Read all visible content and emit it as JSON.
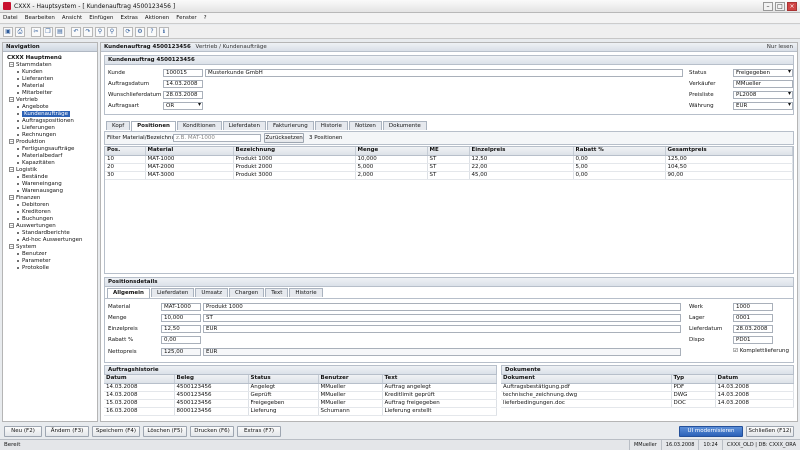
{
  "window": {
    "title": "CXXX - Hauptsystem - [ Kundenauftrag 4500123456 ]"
  },
  "menu": [
    "Datei",
    "Bearbeiten",
    "Ansicht",
    "Einfügen",
    "Extras",
    "Aktionen",
    "Fenster",
    "?"
  ],
  "toolbar_icons": [
    "save-icon",
    "print-icon",
    "cut-icon",
    "copy-icon",
    "paste-icon",
    "undo-icon",
    "redo-icon",
    "find-icon",
    "find-next-icon",
    "refresh-icon",
    "settings-icon",
    "help-icon",
    "info-icon"
  ],
  "nav": {
    "title": "Navigation",
    "root": "CXXX Hauptmenü",
    "groups": [
      {
        "label": "Stammdaten",
        "items": [
          "Kunden",
          "Lieferanten",
          "Material",
          "Mitarbeiter"
        ]
      },
      {
        "label": "Vertrieb",
        "items": [
          "Angebote",
          "Kundenaufträge",
          "Auftragspositionen",
          "Lieferungen",
          "Rechnungen"
        ]
      },
      {
        "label": "Produktion",
        "items": [
          "Fertigungsaufträge",
          "Materialbedarf",
          "Kapazitäten"
        ]
      },
      {
        "label": "Logistik",
        "items": [
          "Bestände",
          "Wareneingang",
          "Warenausgang"
        ]
      },
      {
        "label": "Finanzen",
        "items": [
          "Debitoren",
          "Kreditoren",
          "Buchungen"
        ]
      },
      {
        "label": "Auswertungen",
        "items": [
          "Standardberichte",
          "Ad-hoc Auswertungen"
        ]
      },
      {
        "label": "System",
        "items": [
          "Benutzer",
          "Parameter",
          "Protokolle"
        ]
      }
    ],
    "selected": "Kundenaufträge"
  },
  "crumb": {
    "title": "Kundenauftrag 4500123456",
    "path": "Vertrieb / Kundenaufträge",
    "mode": "Nur lesen"
  },
  "header": {
    "section_title": "Kundenauftrag 4500123456",
    "kunde_label": "Kunde",
    "kunde_nr": "100015",
    "kunde_name": "Musterkunde GmbH",
    "auftragsdatum_label": "Auftragsdatum",
    "auftragsdatum": "14.03.2008",
    "wunschlieferdatum_label": "Wunschlieferdatum",
    "wunschlieferdatum": "28.03.2008",
    "auftragsart_label": "Auftragsart",
    "auftragsart": "OR",
    "status_label": "Status",
    "status": "Freigegeben",
    "verkaeufer_label": "Verkäufer",
    "verkaeufer": "MMueller",
    "preisliste_label": "Preisliste",
    "preisliste": "PL2008",
    "waehrung_label": "Währung",
    "waehrung": "EUR"
  },
  "tabs": [
    "Kopf",
    "Positionen",
    "Konditionen",
    "Lieferdaten",
    "Fakturierung",
    "Historie",
    "Notizen",
    "Dokumente"
  ],
  "active_tab": "Positionen",
  "filter": {
    "label": "Filter Material/Bezeichnung:",
    "placeholder": "z.B. MAT-1000",
    "reset": "Zurücksetzen",
    "count": "3 Positionen"
  },
  "positions": {
    "columns": [
      "Pos.",
      "Material",
      "Bezeichnung",
      "Menge",
      "ME",
      "Einzelpreis",
      "Rabatt %",
      "Gesamtpreis"
    ],
    "rows": [
      [
        "10",
        "MAT-1000",
        "Produkt 1000",
        "10,000",
        "ST",
        "12,50",
        "0,00",
        "125,00"
      ],
      [
        "20",
        "MAT-2000",
        "Produkt 2000",
        "5,000",
        "ST",
        "22,00",
        "5,00",
        "104,50"
      ],
      [
        "30",
        "MAT-3000",
        "Produkt 3000",
        "2,000",
        "ST",
        "45,00",
        "0,00",
        "90,00"
      ]
    ]
  },
  "details": {
    "title": "Positionsdetails",
    "tabs": [
      "Allgemein",
      "Lieferdaten",
      "Umsatz",
      "Chargen",
      "Text",
      "Historie"
    ],
    "material_label": "Material",
    "material": "MAT-1000",
    "material_desc": "Produkt 1000",
    "menge_label": "Menge",
    "menge": "10,000",
    "menge_unit": "ST",
    "einzelpreis_label": "Einzelpreis",
    "einzelpreis": "12,50",
    "einzelpreis_cur": "EUR",
    "rabatt_label": "Rabatt %",
    "rabatt": "0,00",
    "nettopreis_label": "Nettopreis",
    "nettopreis": "125,00",
    "nettopreis_cur": "EUR",
    "werk_label": "Werk",
    "werk": "1000",
    "lager_label": "Lager",
    "lager": "0001",
    "lieferdatum_label": "Lieferdatum",
    "lieferdatum": "28.03.2008",
    "dispo_label": "Dispo",
    "dispo": "PD01",
    "komplett_label": "Komplettlieferung",
    "komplett_check": "☑"
  },
  "history": {
    "title": "Auftragshistorie",
    "columns": [
      "Datum",
      "Beleg",
      "Status",
      "Benutzer",
      "Text"
    ],
    "rows": [
      [
        "14.03.2008",
        "4500123456",
        "Angelegt",
        "MMueller",
        "Auftrag angelegt"
      ],
      [
        "14.03.2008",
        "4500123456",
        "Geprüft",
        "MMueller",
        "Kreditlimit geprüft"
      ],
      [
        "15.03.2008",
        "4500123456",
        "Freigegeben",
        "MMueller",
        "Auftrag freigegeben"
      ],
      [
        "16.03.2008",
        "8000123456",
        "Lieferung",
        "Schumann",
        "Lieferung erstellt"
      ]
    ]
  },
  "docs": {
    "title": "Dokumente",
    "columns": [
      "Dokument",
      "Typ",
      "Datum"
    ],
    "rows": [
      [
        "Auftragsbestätigung.pdf",
        "PDF",
        "14.03.2008"
      ],
      [
        "technische_zeichnung.dwg",
        "DWG",
        "14.03.2008"
      ],
      [
        "lieferbedingungen.doc",
        "DOC",
        "14.03.2008"
      ]
    ]
  },
  "buttons": {
    "new": "Neu (F2)",
    "edit": "Ändern (F3)",
    "save": "Speichern (F4)",
    "delete": "Löschen (F5)",
    "print": "Drucken (F6)",
    "extras": "Extras (F7)",
    "modernize": "UI modernisieren",
    "close": "Schließen (F12)"
  },
  "status": {
    "ready": "Bereit",
    "user": "MMueller",
    "date": "16.03.2008",
    "time": "10:24",
    "system": "CXXX_OLD | DB: CXXX_ORA"
  }
}
